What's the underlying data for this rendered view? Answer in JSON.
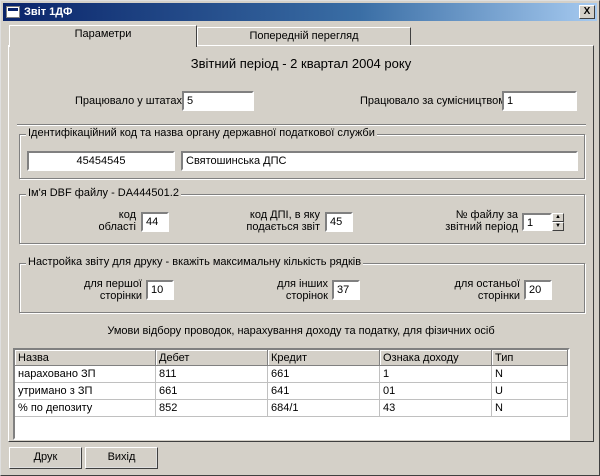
{
  "window": {
    "title": "Звіт 1ДФ",
    "close_label": "X"
  },
  "tabs": [
    {
      "label": "Параметри",
      "active": true
    },
    {
      "label": "Попередній перегляд",
      "active": false
    }
  ],
  "period_title": "Звітний період - 2 квартал 2004 року",
  "staff": {
    "label": "Працювало у штатах",
    "value": "5"
  },
  "parttime": {
    "label": "Працювало за сумісництвом",
    "value": "1"
  },
  "tax_office": {
    "legend": "Ідентифікаційний код та  назва органу державної податкової служби",
    "code": "45454545",
    "name": "Святошинська ДПС"
  },
  "dbf": {
    "legend": "Ім'я DBF файлу - DA444501.2",
    "region_code_label": [
      "код",
      "області"
    ],
    "region_code_value": "44",
    "dpi_code_label": [
      "код ДПІ, в яку",
      "подається звіт"
    ],
    "dpi_code_value": "45",
    "file_no_label": [
      "№ файлу за",
      "звітний період"
    ],
    "file_no_value": "1"
  },
  "print": {
    "legend": "Настройка звіту для друку - вкажіть максимальну кількість рядків",
    "first_label": [
      "для першої",
      "сторінки"
    ],
    "first_value": "10",
    "other_label": [
      "для інших",
      "сторінок"
    ],
    "other_value": "37",
    "last_label": [
      "для останьої",
      "сторінки"
    ],
    "last_value": "20"
  },
  "conditions_title": "Умови відбору проводок, нарахування доходу та податку, для фізичних осіб",
  "grid": {
    "columns": [
      "Назва",
      "Дебет",
      "Кредит",
      "Ознака доходу",
      "Тип"
    ],
    "rows": [
      [
        "нараховано ЗП",
        "811",
        "661",
        "1",
        "N"
      ],
      [
        "утримано з ЗП",
        "661",
        "641",
        "01",
        "U"
      ],
      [
        "% по депозиту",
        "852",
        "684/1",
        "43",
        "N"
      ]
    ]
  },
  "buttons": {
    "print": "Друк",
    "exit": "Вихід"
  },
  "colors": {
    "titlebar_start": "#0a246a",
    "titlebar_end": "#a6caf0",
    "face": "#d4d0c8"
  }
}
